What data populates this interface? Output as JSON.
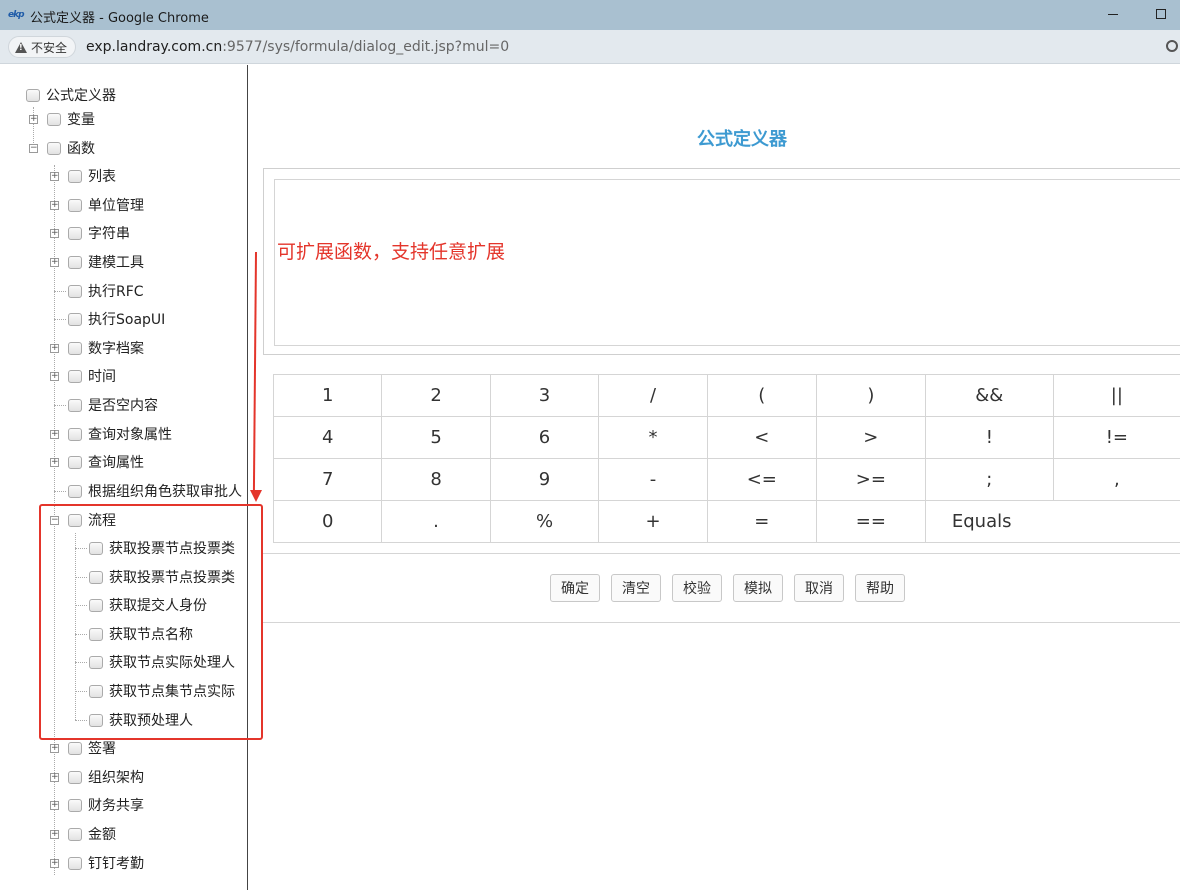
{
  "window": {
    "title": "公式定义器 - Google Chrome",
    "app_icon": "ekp"
  },
  "addressbar": {
    "security_label": "不安全",
    "url_host": "exp.landray.com.cn",
    "url_rest": ":9577/sys/formula/dialog_edit.jsp?mul=0"
  },
  "tree": {
    "root": "公式定义器",
    "variables": "变量",
    "functions": "函数",
    "items": {
      "list": "列表",
      "unit_mgmt": "单位管理",
      "string": "字符串",
      "modeling": "建模工具",
      "rfc": "执行RFC",
      "soapui": "执行SoapUI",
      "archive": "数字档案",
      "time": "时间",
      "is_empty": "是否空内容",
      "query_obj_attr": "查询对象属性",
      "query_attr": "查询属性",
      "get_approver": "根据组织角色获取审批人",
      "workflow": "流程",
      "wf_vote1": "获取投票节点投票类",
      "wf_vote2": "获取投票节点投票类",
      "wf_submitter": "获取提交人身份",
      "wf_node_name": "获取节点名称",
      "wf_node_actual": "获取节点实际处理人",
      "wf_node_set": "获取节点集节点实际",
      "wf_pre_handler": "获取预处理人",
      "sign": "签署",
      "org": "组织架构",
      "finance": "财务共享",
      "amount": "金额",
      "dingding": "钉钉考勤"
    }
  },
  "main": {
    "heading": "公式定义器",
    "annotation": "可扩展函数，支持任意扩展",
    "keypad": {
      "r1": [
        "1",
        "2",
        "3",
        "/",
        "(",
        ")",
        "&&",
        "||"
      ],
      "r2": [
        "4",
        "5",
        "6",
        "*",
        "<",
        ">",
        "!",
        "!="
      ],
      "r3": [
        "7",
        "8",
        "9",
        "-",
        "<=",
        ">=",
        ";",
        ","
      ],
      "r4": [
        "0",
        ".",
        "%",
        "+",
        "=",
        "==",
        "Equals"
      ]
    },
    "buttons": {
      "confirm": "确定",
      "clear": "清空",
      "validate": "校验",
      "simulate": "模拟",
      "cancel": "取消",
      "help": "帮助"
    }
  },
  "colors": {
    "heading": "#3d9ad1",
    "annotation": "#e4352b",
    "titlebar": "#a9c0d0"
  }
}
